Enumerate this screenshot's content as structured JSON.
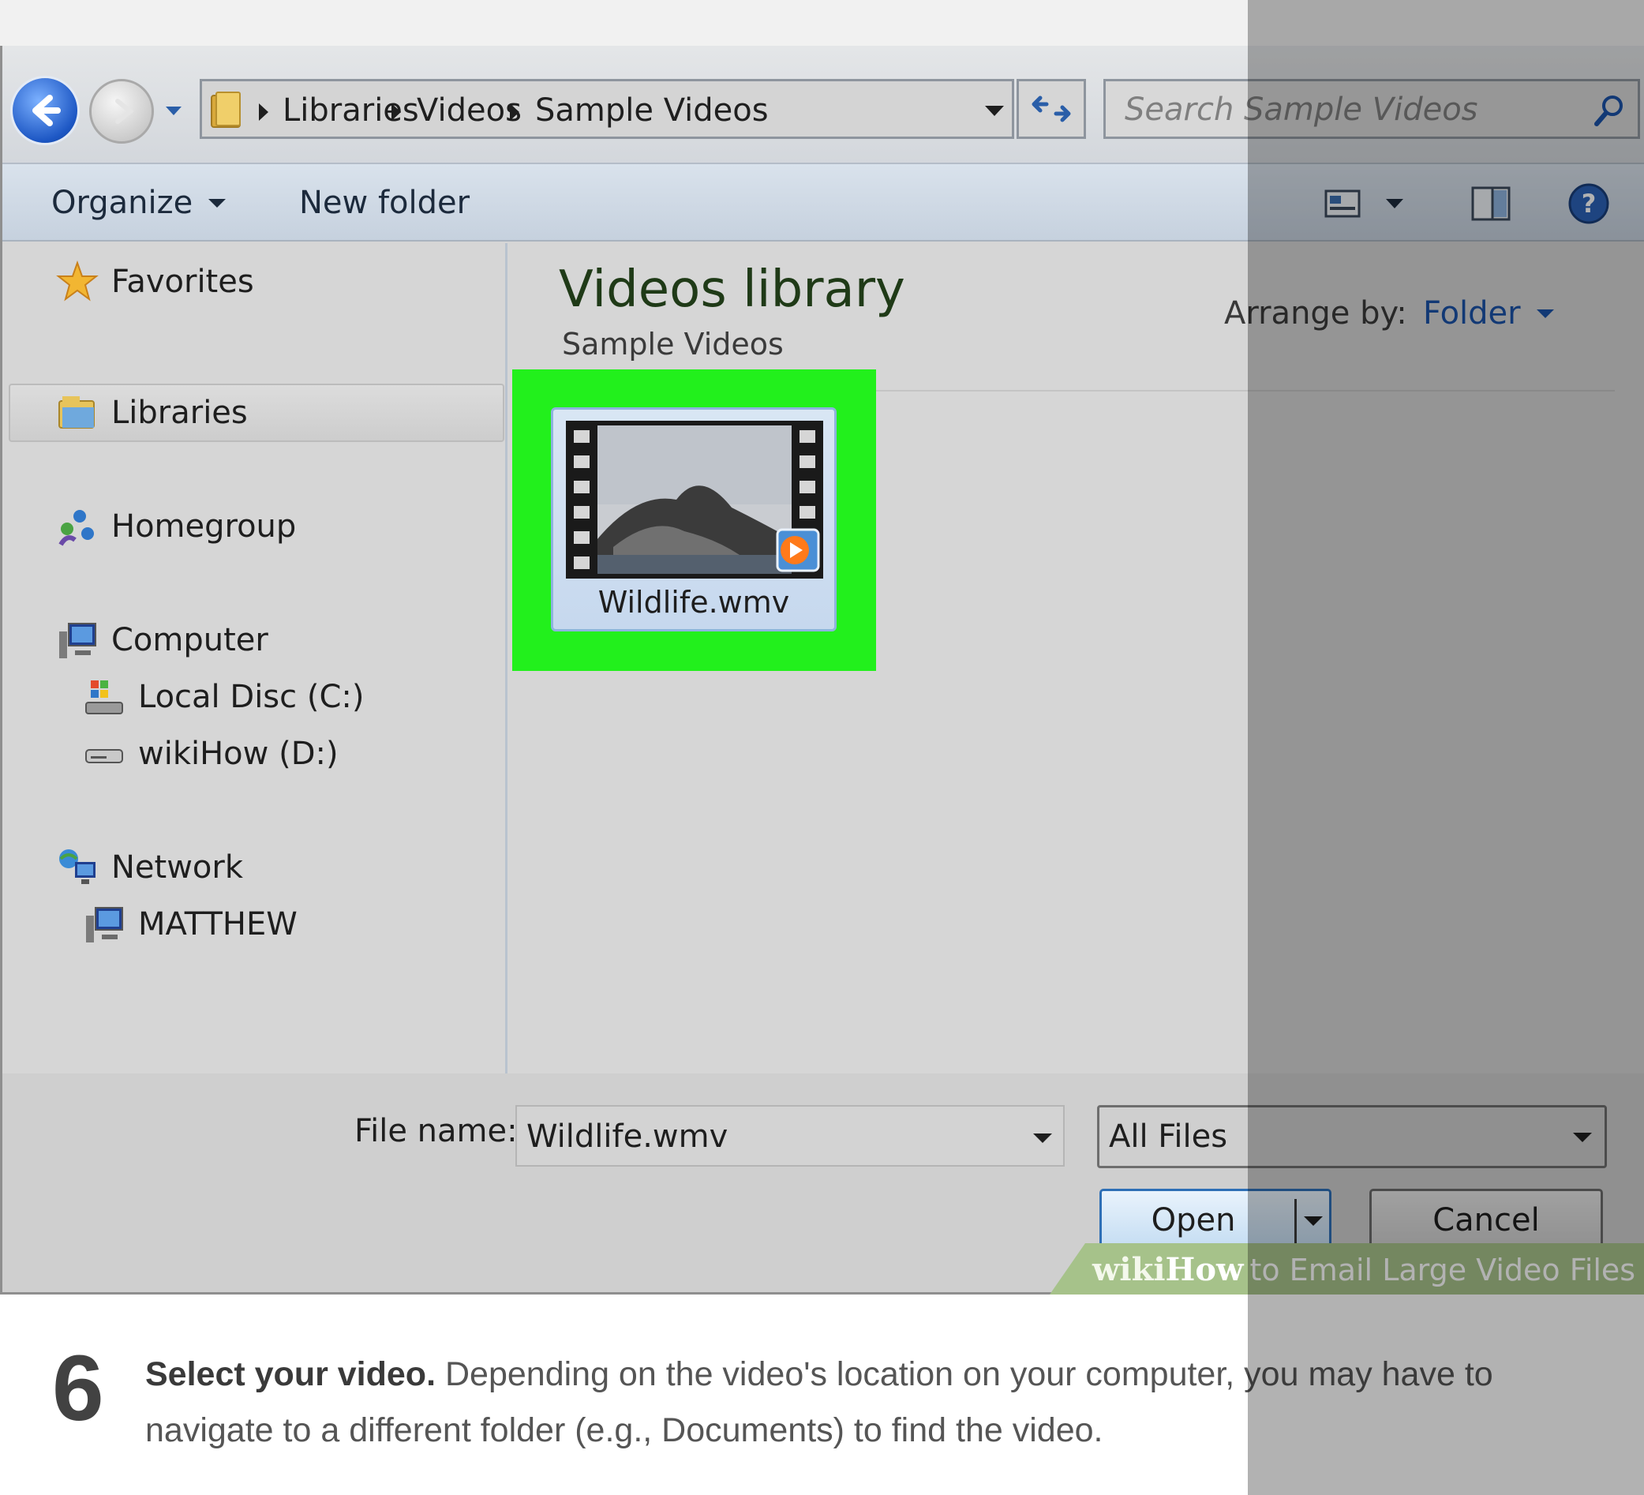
{
  "dialog": {
    "address": {
      "crumbs": [
        "Libraries",
        "Videos",
        "Sample Videos"
      ]
    },
    "search": {
      "placeholder": "Search Sample Videos"
    },
    "toolbar": {
      "organize_label": "Organize",
      "new_folder_label": "New folder"
    },
    "sidebar": {
      "items": [
        {
          "label": "Favorites",
          "icon": "star-icon"
        },
        {
          "label": "Libraries",
          "icon": "libraries-icon",
          "selected": true
        },
        {
          "label": "Homegroup",
          "icon": "homegroup-icon"
        },
        {
          "label": "Computer",
          "icon": "computer-icon"
        },
        {
          "label": "Local Disc (C:)",
          "icon": "local-disc-icon"
        },
        {
          "label": "wikiHow (D:)",
          "icon": "drive-icon"
        },
        {
          "label": "Network",
          "icon": "network-icon"
        },
        {
          "label": "MATTHEW",
          "icon": "computer-icon"
        }
      ]
    },
    "content": {
      "title": "Videos library",
      "subtitle": "Sample Videos",
      "arrange_label": "Arrange by:",
      "arrange_value": "Folder",
      "files": [
        {
          "name": "Wildlife.wmv",
          "highlighted": true
        }
      ]
    },
    "footer": {
      "file_name_label": "File name:",
      "file_name_value": "Wildlife.wmv",
      "file_type": "All Files",
      "open_label": "Open",
      "cancel_label": "Cancel"
    }
  },
  "watermark": {
    "wiki": "wiki",
    "how": "How",
    "title": "to Email Large Video Files"
  },
  "caption": {
    "step": "6",
    "bold": "Select your video.",
    "text": " Depending on the video's location on your computer, you may have to navigate to a different folder (e.g., Documents) to find the video."
  },
  "colors": {
    "highlight": "#22f01c",
    "accent": "#1b52a8",
    "library_title": "#1f3a17"
  }
}
